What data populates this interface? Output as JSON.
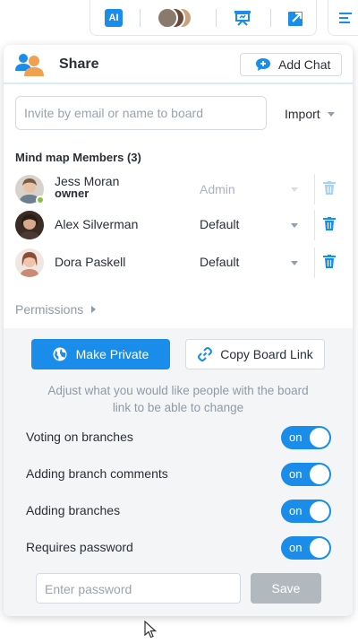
{
  "toolbar": {
    "ai_label": "AI",
    "icons": [
      "ai-icon",
      "collaborators-avatars",
      "presentation-icon",
      "export-icon",
      "menu-icon"
    ]
  },
  "share": {
    "title": "Share",
    "add_chat_label": "Add Chat",
    "invite_placeholder": "Invite by email or name to board",
    "import_label": "Import",
    "members_heading": "Mind map Members (3)",
    "members": [
      {
        "name": "Jess Moran",
        "sub": "owner",
        "role": "Admin",
        "role_disabled": true,
        "online": true
      },
      {
        "name": "Alex Silverman",
        "sub": "",
        "role": "Default",
        "role_disabled": false,
        "online": false
      },
      {
        "name": "Dora Paskell",
        "sub": "",
        "role": "Default",
        "role_disabled": false,
        "online": false
      }
    ],
    "permissions_label": "Permissions"
  },
  "link_settings": {
    "make_private_label": "Make Private",
    "copy_link_label": "Copy Board Link",
    "hint": "Adjust what you would like people with the board link to be able to change",
    "options": [
      {
        "label": "Voting on branches",
        "state": "on"
      },
      {
        "label": "Adding branch comments",
        "state": "on"
      },
      {
        "label": "Adding branches",
        "state": "on"
      },
      {
        "label": "Requires password",
        "state": "on"
      }
    ],
    "password_placeholder": "Enter password",
    "save_label": "Save"
  },
  "colors": {
    "accent": "#1a8ce9",
    "disabled_button": "#b1b8be",
    "online": "#8cbf3f"
  }
}
